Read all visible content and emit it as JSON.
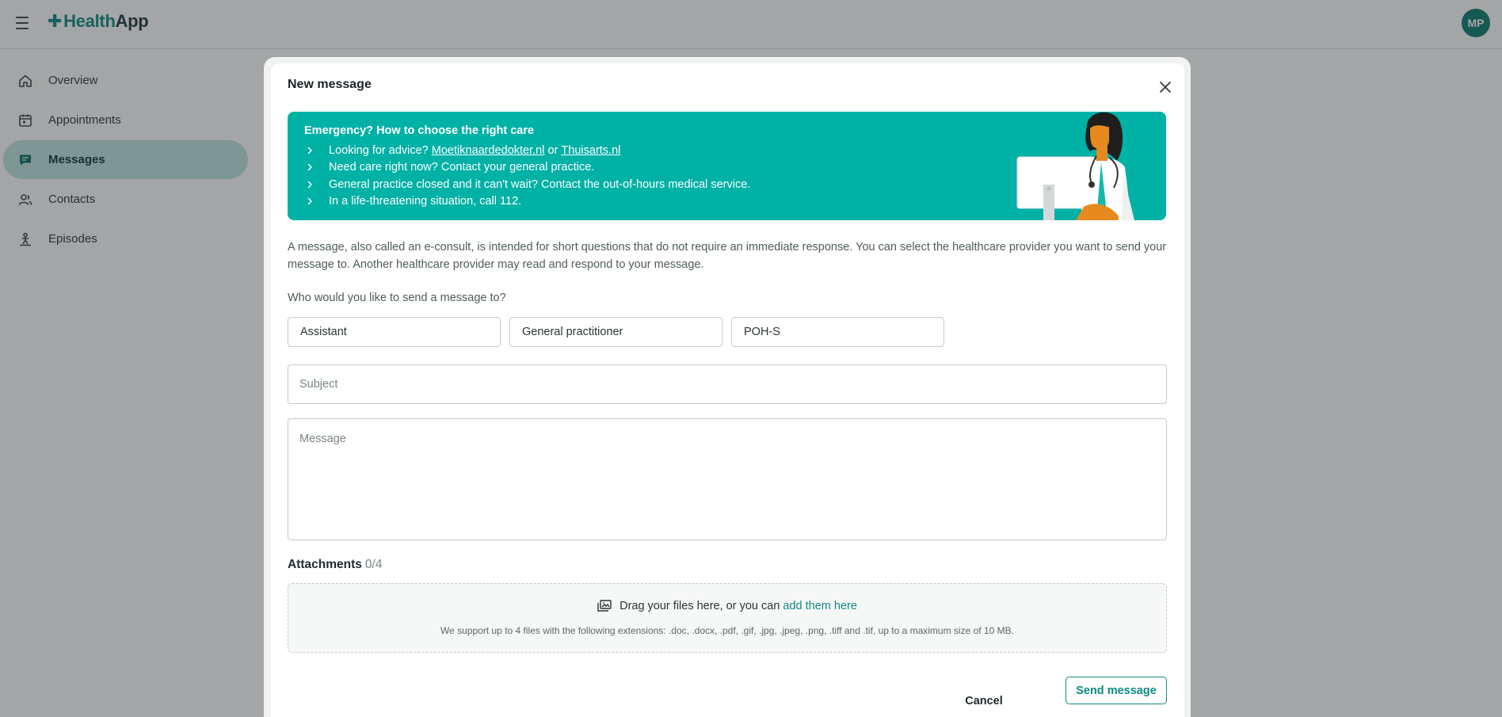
{
  "app": {
    "logo_part1": "Health",
    "logo_part2": "App",
    "user_initials": "MP"
  },
  "sidebar": {
    "items": [
      {
        "label": "Overview",
        "icon": "home-icon",
        "active": false
      },
      {
        "label": "Appointments",
        "icon": "calendar-icon",
        "active": false
      },
      {
        "label": "Messages",
        "icon": "chat-icon",
        "active": true
      },
      {
        "label": "Contacts",
        "icon": "people-icon",
        "active": false
      },
      {
        "label": "Episodes",
        "icon": "episodes-icon",
        "active": false
      }
    ]
  },
  "modal": {
    "title": "New message",
    "banner": {
      "title": "Emergency? How to choose the right care",
      "items": [
        {
          "prefix": "Looking for advice?",
          "link1": "Moetiknaardedokter.nl",
          "joiner": "or",
          "link2": "Thuisarts.nl"
        },
        {
          "text": "Need care right now? Contact your general practice."
        },
        {
          "text": "General practice closed and it can't wait? Contact the out-of-hours medical service."
        },
        {
          "text": "In a life-threatening situation, call 112."
        }
      ]
    },
    "intro": "A message, also called an e-consult, is intended for short questions that do not require an immediate response. You can select the healthcare provider you want to send your message to. Another healthcare provider may read and respond to your message.",
    "recipient_label": "Who would you like to send a message to?",
    "recipients": [
      "Assistant",
      "General practitioner",
      "POH-S"
    ],
    "subject_placeholder": "Subject",
    "message_placeholder": "Message",
    "attachments": {
      "title": "Attachments",
      "count": "0/4",
      "drop_text": "Drag your files here, or you can",
      "drop_link": "add them here",
      "note": "We support up to 4 files with the following extensions: .doc, .docx, .pdf, .gif, .jpg, .jpeg, .png, .tiff and .tif, up to a maximum size of 10 MB."
    },
    "cancel_label": "Cancel",
    "send_label": "Send message"
  },
  "colors": {
    "brand": "#0e8c83",
    "banner": "#00b1a6",
    "active_nav": "#bfe5e1"
  }
}
